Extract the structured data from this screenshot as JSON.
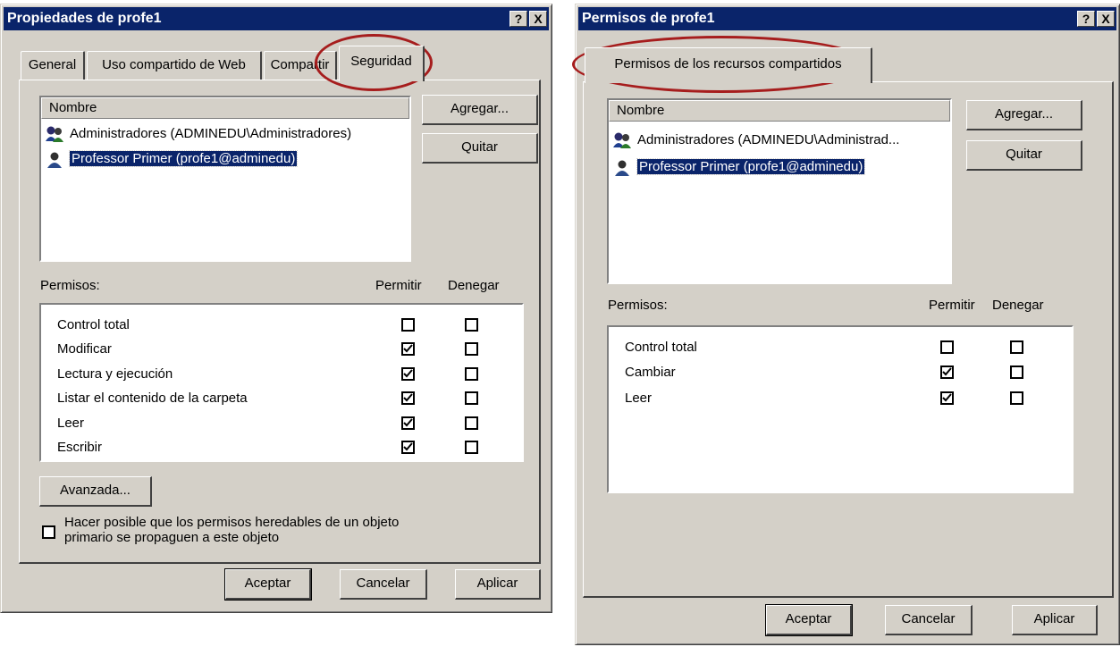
{
  "left_dialog": {
    "title": "Propiedades de profe1",
    "help_button": "?",
    "close_button": "X",
    "tabs": [
      "General",
      "Uso compartido de Web",
      "Compartir",
      "Seguridad"
    ],
    "active_tab": "Seguridad",
    "list_header": "Nombre",
    "users": [
      {
        "label": "Administradores (ADMINEDU\\Administradores)",
        "selected": false
      },
      {
        "label": "Professor Primer (profe1@adminedu)",
        "selected": true
      }
    ],
    "add_button": "Agregar...",
    "remove_button": "Quitar",
    "permissions_label": "Permisos:",
    "allow_header": "Permitir",
    "deny_header": "Denegar",
    "permissions": [
      {
        "label": "Control total",
        "allow": false,
        "deny": false
      },
      {
        "label": "Modificar",
        "allow": true,
        "deny": false
      },
      {
        "label": "Lectura y ejecución",
        "allow": true,
        "deny": false
      },
      {
        "label": "Listar el contenido de la carpeta",
        "allow": true,
        "deny": false
      },
      {
        "label": "Leer",
        "allow": true,
        "deny": false
      },
      {
        "label": "Escribir",
        "allow": true,
        "deny": false
      }
    ],
    "advanced_button": "Avanzada...",
    "inherit_checkbox_label_line1": "Hacer posible que los permisos heredables de un objeto",
    "inherit_checkbox_label_line2": "primario se propaguen a este objeto",
    "inherit_checked": false,
    "ok_button": "Aceptar",
    "cancel_button": "Cancelar",
    "apply_button": "Aplicar"
  },
  "right_dialog": {
    "title": "Permisos de profe1",
    "help_button": "?",
    "close_button": "X",
    "tab": "Permisos de los recursos compartidos",
    "list_header": "Nombre",
    "users": [
      {
        "label": "Administradores (ADMINEDU\\Administrad...",
        "selected": false
      },
      {
        "label": "Professor Primer (profe1@adminedu)",
        "selected": true
      }
    ],
    "add_button": "Agregar...",
    "remove_button": "Quitar",
    "permissions_label": "Permisos:",
    "allow_header": "Permitir",
    "deny_header": "Denegar",
    "permissions": [
      {
        "label": "Control total",
        "allow": false,
        "deny": false
      },
      {
        "label": "Cambiar",
        "allow": true,
        "deny": false
      },
      {
        "label": "Leer",
        "allow": true,
        "deny": false
      }
    ],
    "ok_button": "Aceptar",
    "cancel_button": "Cancelar",
    "apply_button": "Aplicar"
  },
  "colors": {
    "titlebar": "#0a246a",
    "face": "#d4d0c8",
    "annotation_circle": "#a61d1d"
  }
}
